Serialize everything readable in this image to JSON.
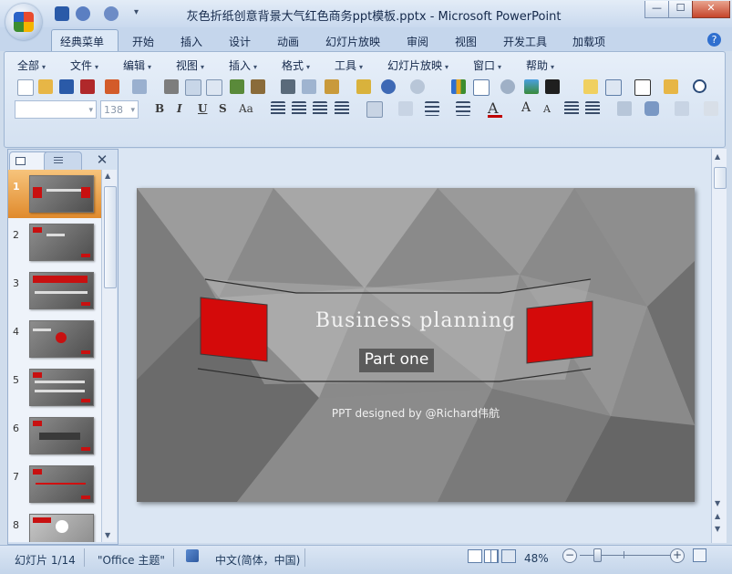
{
  "window": {
    "title": "灰色折纸创意背景大气红色商务ppt模板.pptx - Microsoft PowerPoint",
    "minimize_glyph": "—",
    "maximize_glyph": "☐",
    "close_glyph": "✕"
  },
  "quick_access": [
    "save-icon",
    "undo-icon",
    "redo-icon",
    "customize-icon"
  ],
  "ribbon_tabs": [
    "经典菜单",
    "开始",
    "插入",
    "设计",
    "动画",
    "幻灯片放映",
    "审阅",
    "视图",
    "开发工具",
    "加载项"
  ],
  "classic_menus": [
    "全部",
    "文件",
    "编辑",
    "视图",
    "插入",
    "格式",
    "工具",
    "幻灯片放映",
    "窗口",
    "帮助"
  ],
  "font_box": {
    "font_name": "",
    "font_size": "138"
  },
  "format_buttons": [
    "B",
    "I",
    "U",
    "S",
    "Aa"
  ],
  "slides": {
    "numbers": [
      "1",
      "2",
      "3",
      "4",
      "5",
      "6",
      "7",
      "8"
    ],
    "selected": "1"
  },
  "slide": {
    "title": "Business planning",
    "subtitle": "Part one",
    "credit": "PPT designed by @Richard伟航",
    "colors": {
      "accent_red": "#d40a0a",
      "background_gray": "#8a8a8a"
    }
  },
  "status": {
    "slide_index": "幻灯片 1/14",
    "theme": "\"Office 主题\"",
    "language": "中文(简体，中国)",
    "zoom": "48%",
    "zoom_out": "−",
    "zoom_in": "+"
  },
  "help_glyph": "?",
  "panel_close_glyph": "✕"
}
